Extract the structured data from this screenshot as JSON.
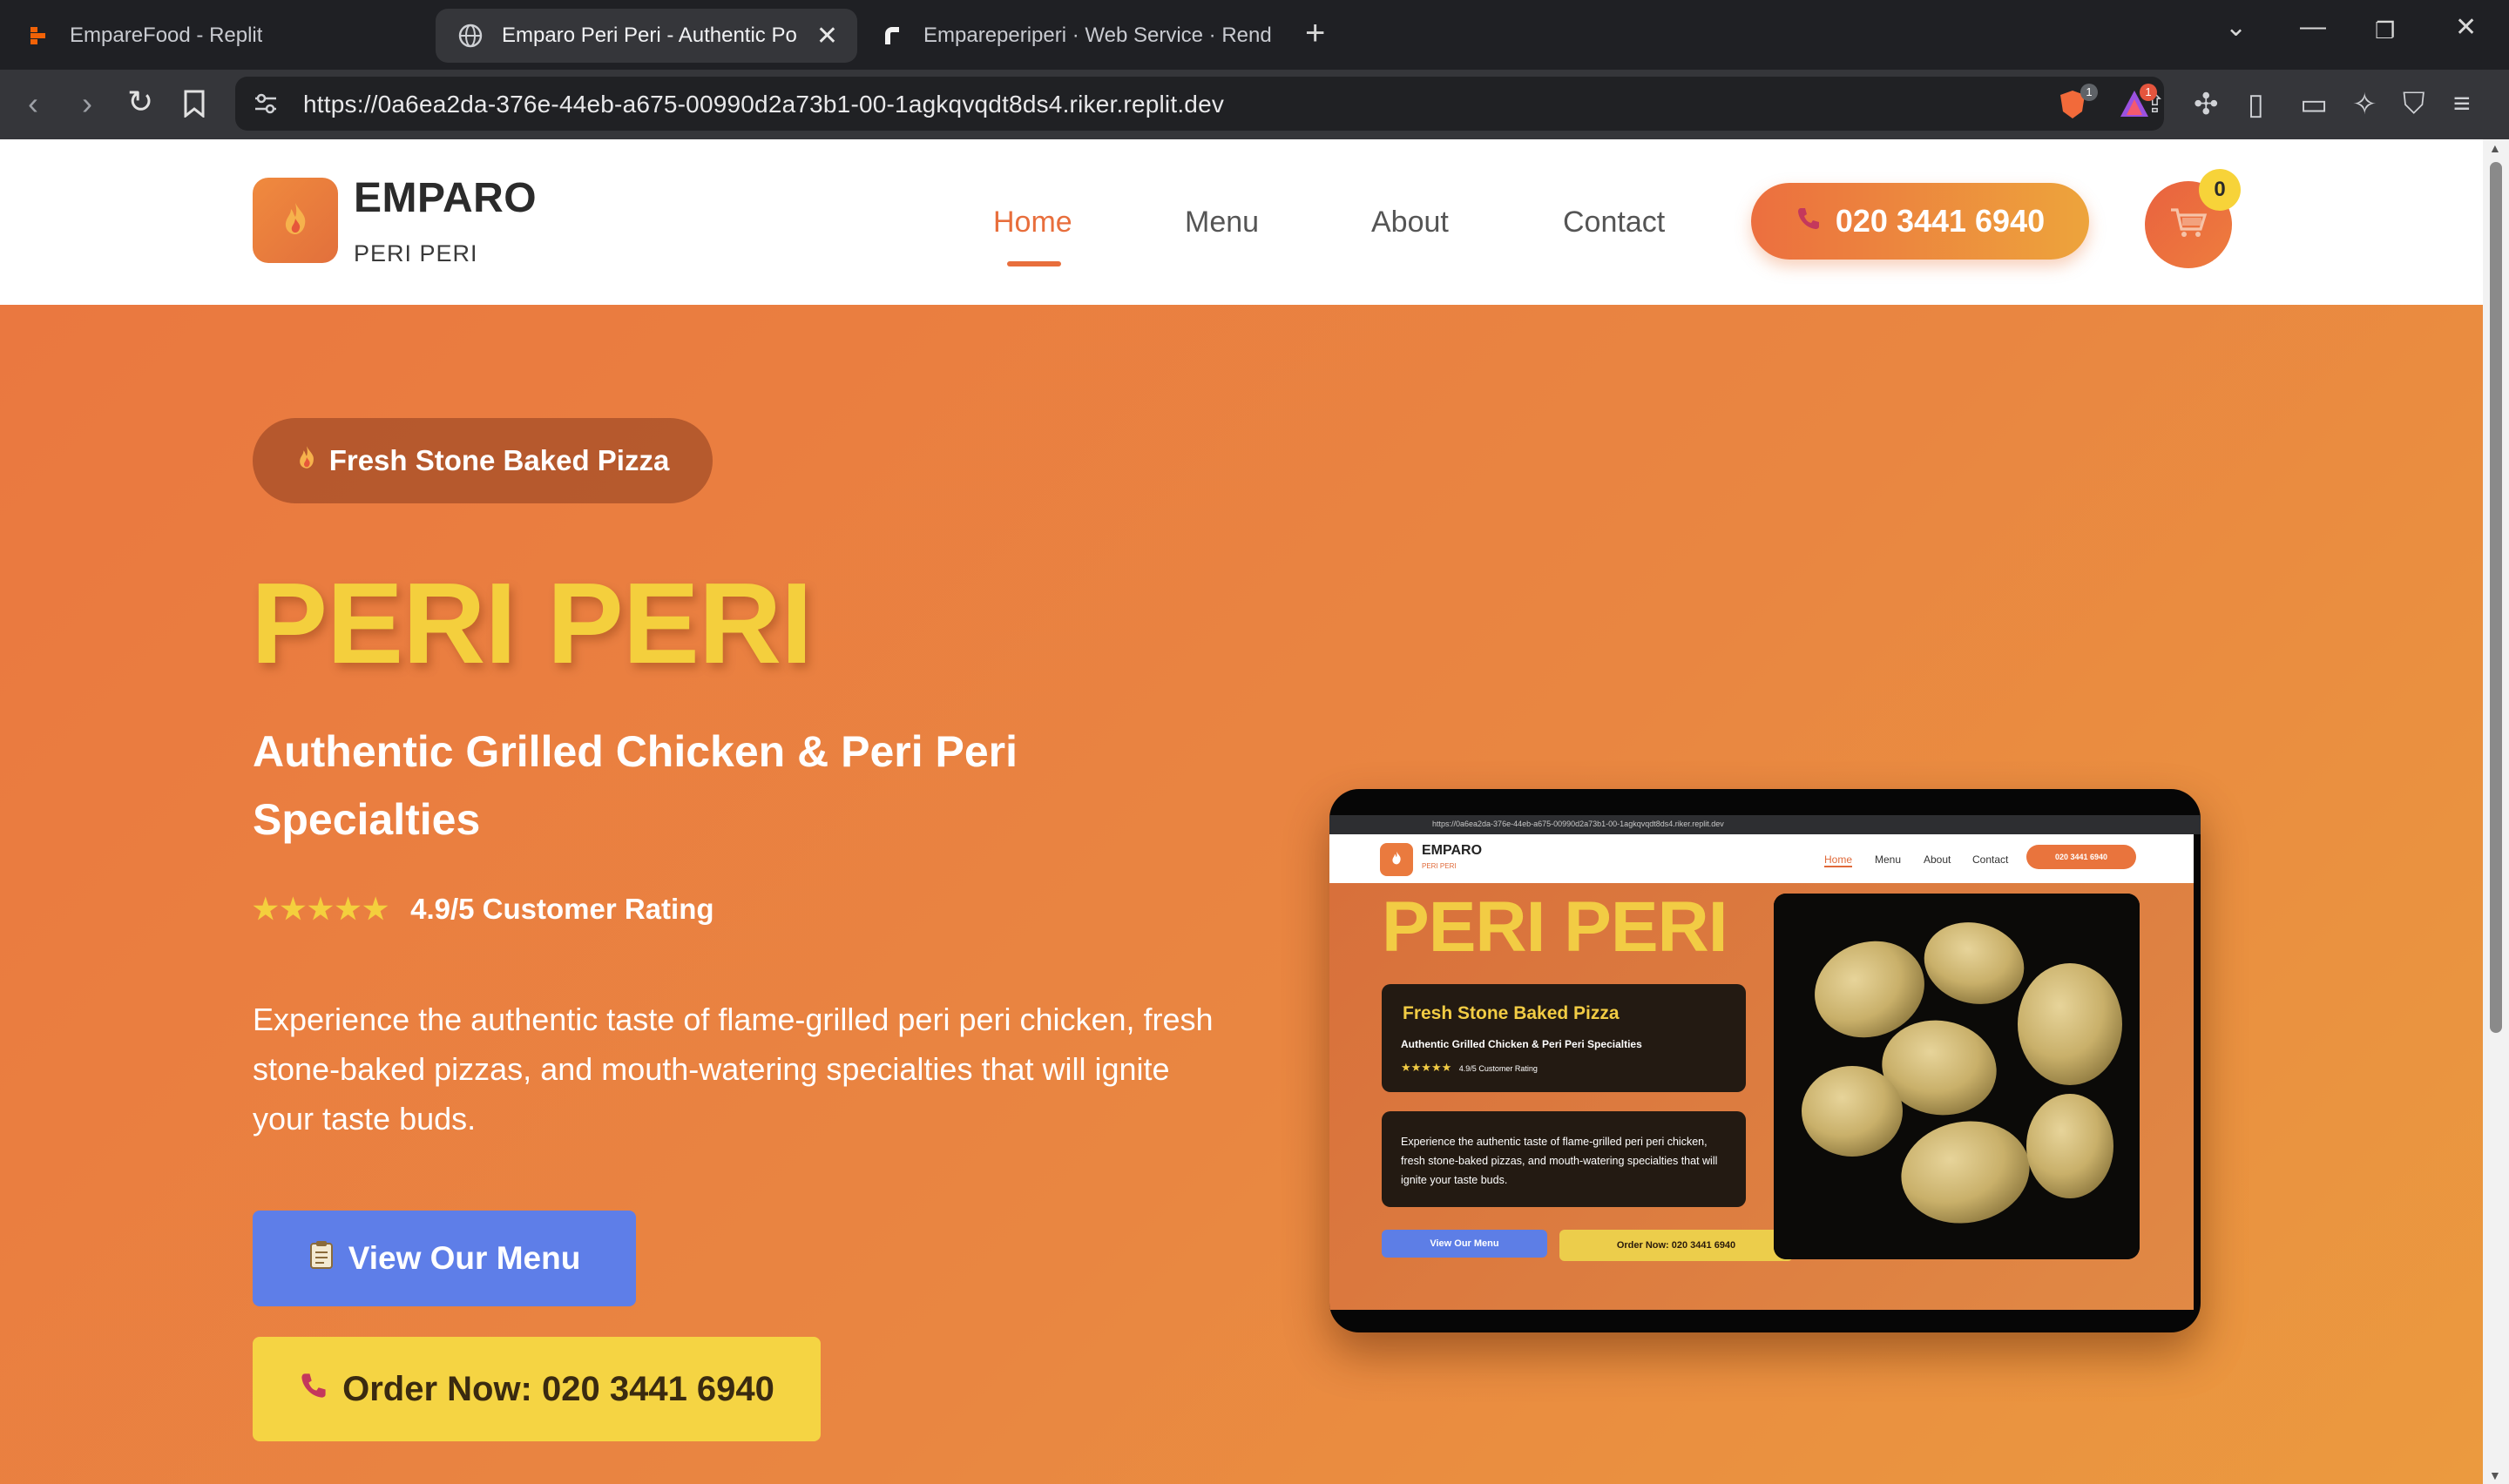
{
  "browser": {
    "tabs": [
      {
        "title": "EmpareFood - Replit",
        "icon": "replit-icon",
        "active": false
      },
      {
        "title": "Emparo Peri Peri - Authentic Port",
        "icon": "globe-icon",
        "active": true
      },
      {
        "title": "Empareperiperi · Web Service · Rend",
        "icon": "render-icon",
        "active": false
      }
    ],
    "url": "https://0a6ea2da-376e-44eb-a675-00990d2a73b1-00-1agkqvqdt8ds4.riker.replit.dev",
    "extension_badges": [
      "1",
      "1"
    ]
  },
  "header": {
    "brand": "EMPARO",
    "brand_sub": "PERI PERI",
    "nav": [
      "Home",
      "Menu",
      "About",
      "Contact"
    ],
    "active_nav": "Home",
    "phone": "020 3441 6940",
    "cart_count": "0"
  },
  "hero": {
    "pill": "Fresh Stone Baked Pizza",
    "title": "PERI PERI",
    "subtitle": "Authentic Grilled Chicken & Peri Peri Specialties",
    "stars": "★★★★★",
    "rating": "4.9/5 Customer Rating",
    "description": "Experience the authentic taste of flame-grilled peri peri chicken, fresh stone-baked pizzas, and mouth-watering specialties that will ignite your taste buds.",
    "menu_button": "View Our Menu",
    "order_button": "Order Now: 020 3441 6940"
  },
  "preview": {
    "url": "https://0a6ea2da-376e-44eb-a675-00990d2a73b1-00-1agkqvqdt8ds4.riker.replit.dev",
    "brand": "EMPARO",
    "brand_sub": "PERI PERI",
    "nav": [
      "Home",
      "Menu",
      "About",
      "Contact"
    ],
    "phone": "020 3441 6940",
    "title": "PERI PERI",
    "card_title": "Fresh Stone Baked Pizza",
    "card_subtitle": "Authentic Grilled Chicken & Peri Peri Specialties",
    "stars": "★★★★★",
    "rating": "4.9/5 Customer Rating",
    "description": "Experience the authentic taste of flame-grilled peri peri chicken, fresh stone-baked pizzas, and mouth-watering specialties that will ignite your taste buds.",
    "menu_button": "View Our Menu",
    "order_button": "Order Now: 020 3441 6940"
  },
  "colors": {
    "accent": "#e86e3c",
    "yellow": "#f4cf3d",
    "blue": "#5e7ee8",
    "hero_start": "#ea7840",
    "hero_end": "#eb9a3f"
  }
}
